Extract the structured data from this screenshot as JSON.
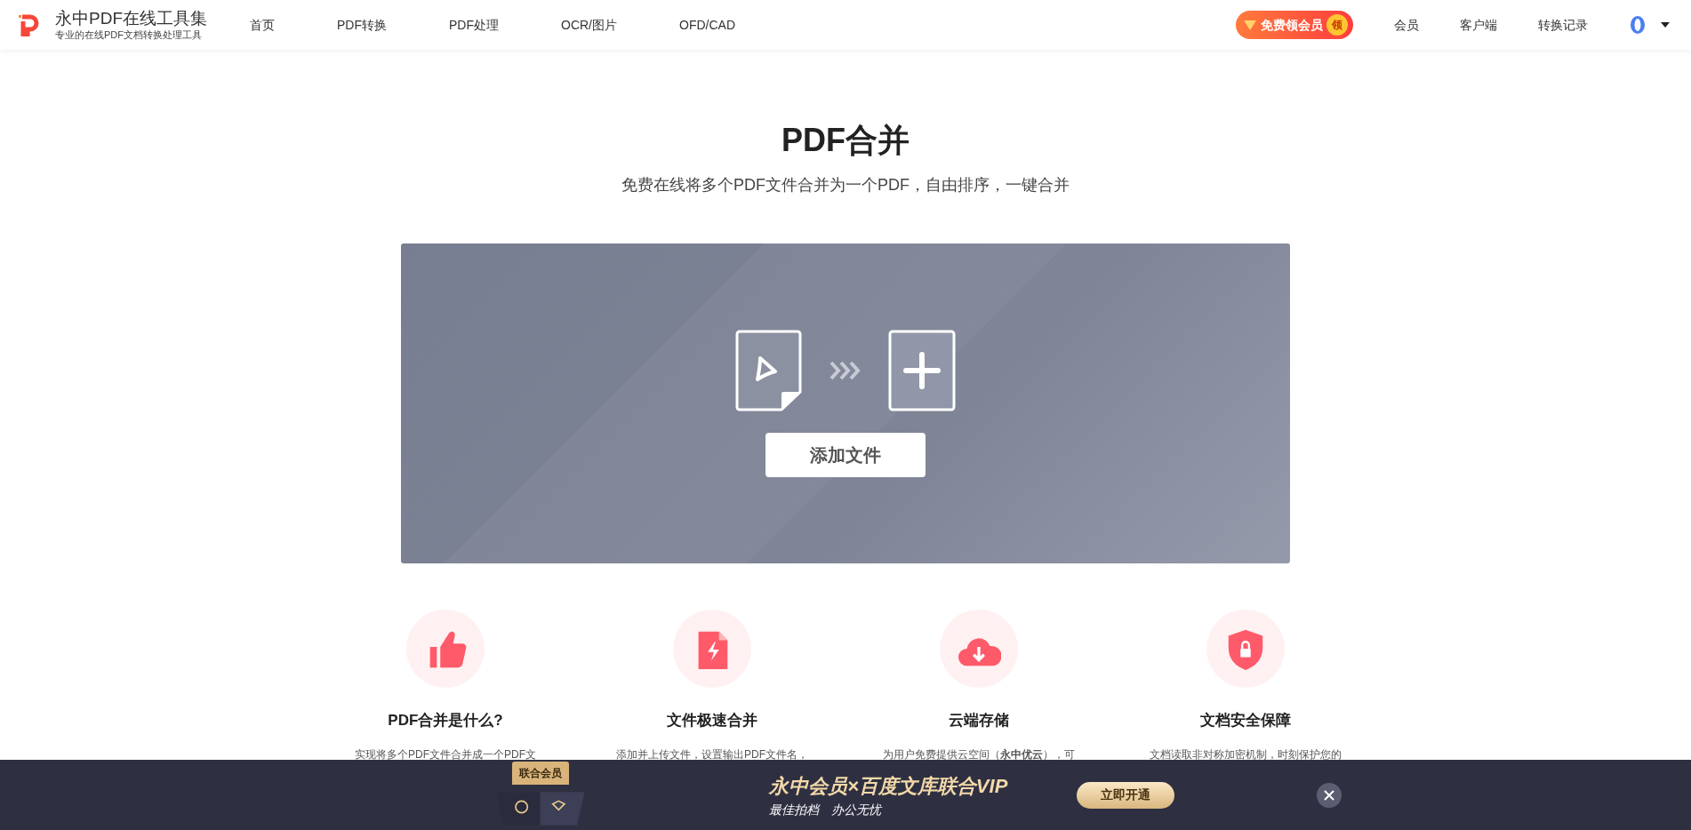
{
  "header": {
    "brand_title": "永中PDF在线工具集",
    "brand_subtitle": "专业的在线PDF文档转换处理工具",
    "nav": [
      {
        "label": "首页"
      },
      {
        "label": "PDF转换"
      },
      {
        "label": "PDF处理"
      },
      {
        "label": "OCR/图片"
      },
      {
        "label": "OFD/CAD"
      }
    ],
    "promo_badge": {
      "label": "免费领会员",
      "tag": "领"
    },
    "right_links": [
      {
        "label": "会员"
      },
      {
        "label": "客户端"
      },
      {
        "label": "转换记录"
      }
    ]
  },
  "hero": {
    "title": "PDF合并",
    "subtitle": "免费在线将多个PDF文件合并为一个PDF，自由排序，一键合并"
  },
  "upload": {
    "button": "添加文件"
  },
  "features": [
    {
      "kind": "thumb",
      "title": "PDF合并是什么?",
      "text": "实现将多个PDF文件合并成一个PDF文"
    },
    {
      "kind": "bolt",
      "title": "文件极速合并",
      "text": "添加并上传文件，设置输出PDF文件名，"
    },
    {
      "kind": "cloud",
      "title": "云端存储",
      "text": "为用户免费提供云空间（**永中优云**），可"
    },
    {
      "kind": "shield",
      "title": "文档安全保障",
      "text": "文档读取非对称加密机制，时刻保护您的"
    }
  ],
  "banner": {
    "box_label": "联合会员",
    "title": "永中会员×百度文库联合VIP",
    "subtitle": "最佳拍档　办公无忧",
    "button": "立即开通"
  }
}
